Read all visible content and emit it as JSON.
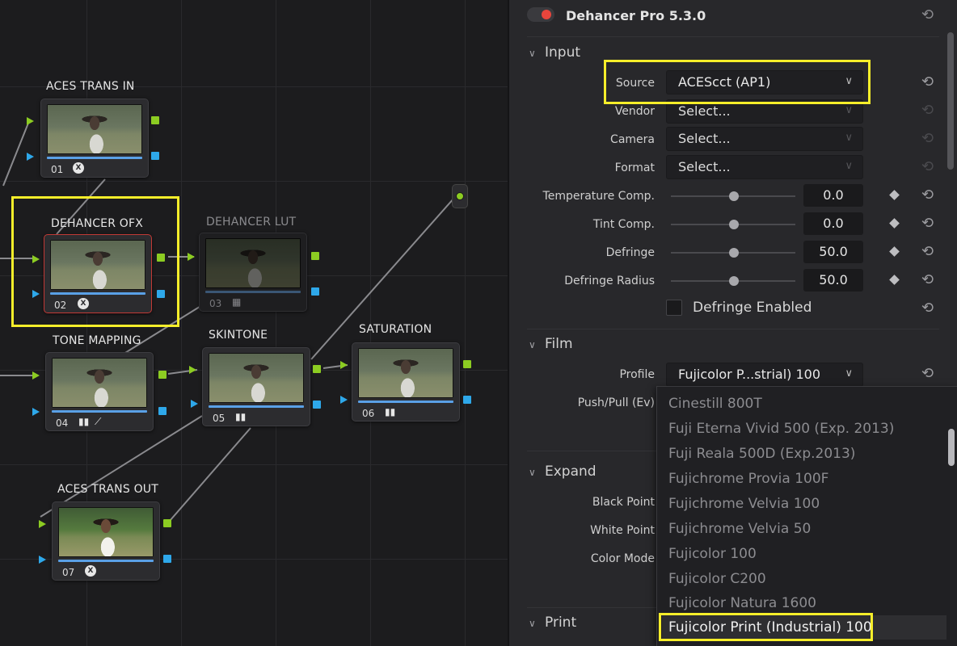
{
  "nodes": [
    {
      "label": "ACES TRANS IN",
      "num": "01",
      "icon": "aces-icon"
    },
    {
      "label": "DEHANCER OFX",
      "num": "02",
      "icon": "aces-icon",
      "selected": true
    },
    {
      "label": "DEHANCER LUT",
      "num": "03",
      "icon": "grid-icon",
      "disabled": true
    },
    {
      "label": "TONE MAPPING",
      "num": "04",
      "icon": "curves-icon"
    },
    {
      "label": "SKINTONE",
      "num": "05",
      "icon": "bars-icon"
    },
    {
      "label": "SATURATION",
      "num": "06",
      "icon": "bars-icon"
    },
    {
      "label": "ACES TRANS OUT",
      "num": "07",
      "icon": "aces-icon"
    }
  ],
  "inspector": {
    "title": "Dehancer Pro 5.3.0",
    "plugin_enabled": true,
    "input": {
      "heading": "Input",
      "source_label": "Source",
      "source_value": "ACEScct (AP1)",
      "vendor_label": "Vendor",
      "vendor_value": "Select...",
      "camera_label": "Camera",
      "camera_value": "Select...",
      "format_label": "Format",
      "format_value": "Select...",
      "temp_label": "Temperature Comp.",
      "temp_value": "0.0",
      "tint_label": "Tint Comp.",
      "tint_value": "0.0",
      "defringe_label": "Defringe",
      "defringe_value": "50.0",
      "radius_label": "Defringe Radius",
      "radius_value": "50.0",
      "defringe_enabled_label": "Defringe Enabled"
    },
    "film": {
      "heading": "Film",
      "profile_label": "Profile",
      "profile_value": "Fujicolor P...strial) 100",
      "pushpull_label": "Push/Pull (Ev)"
    },
    "expand": {
      "heading": "Expand",
      "black_label": "Black Point",
      "white_label": "White Point",
      "mode_label": "Color Mode"
    },
    "print": {
      "heading": "Print"
    }
  },
  "profile_options": [
    "Cinestill 800T",
    "Fuji Eterna Vivid 500 (Exp. 2013)",
    "Fuji Reala 500D (Exp.2013)",
    "Fujichrome Provia 100F",
    "Fujichrome Velvia 100",
    "Fujichrome Velvia 50",
    "Fujicolor 100",
    "Fujicolor C200",
    "Fujicolor Natura 1600",
    "Fujicolor Print (Industrial) 100"
  ],
  "profile_selected": "Fujicolor Print (Industrial) 100",
  "colors": {
    "highlight": "#f6ee2a",
    "port_green": "#8ccc22",
    "port_blue": "#2ea8ea",
    "selected_node_border": "#c23a36",
    "toggle_on": "#e8453c"
  }
}
